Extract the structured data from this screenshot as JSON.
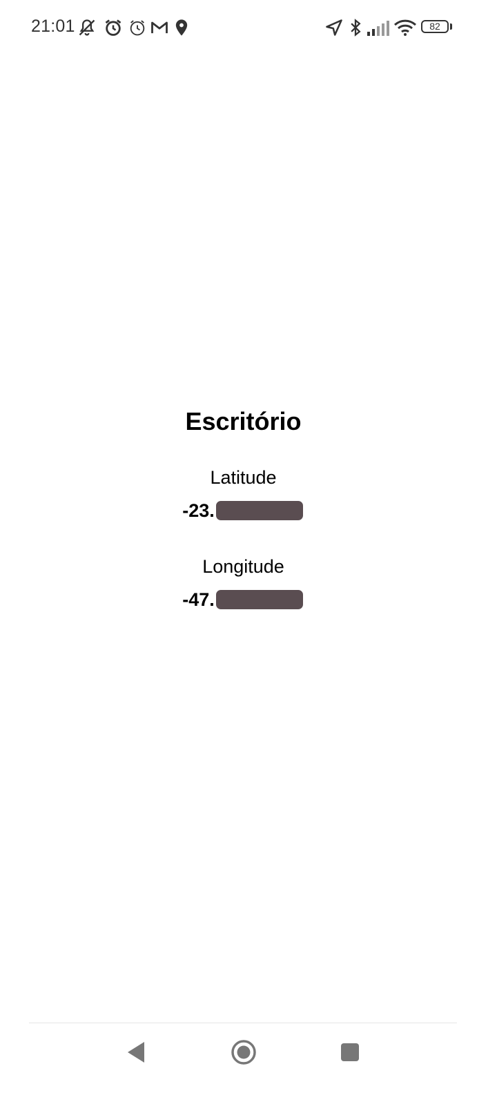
{
  "status_bar": {
    "time": "21:01",
    "battery_level": "82",
    "left_icons": [
      "vibrate-silent-icon",
      "alarm-icon",
      "alarm-outline-icon",
      "gmail-icon",
      "location-pin-icon"
    ],
    "right_icons": [
      "navigation-arrow-icon",
      "bluetooth-icon",
      "signal-icon",
      "wifi-icon",
      "battery-icon"
    ]
  },
  "main": {
    "title": "Escritório",
    "latitude_label": "Latitude",
    "latitude_value": "-23.",
    "longitude_label": "Longitude",
    "longitude_value": "-47."
  },
  "nav_bar": {
    "back_icon": "back-triangle-icon",
    "home_icon": "home-circle-icon",
    "recents_icon": "recents-square-icon"
  }
}
